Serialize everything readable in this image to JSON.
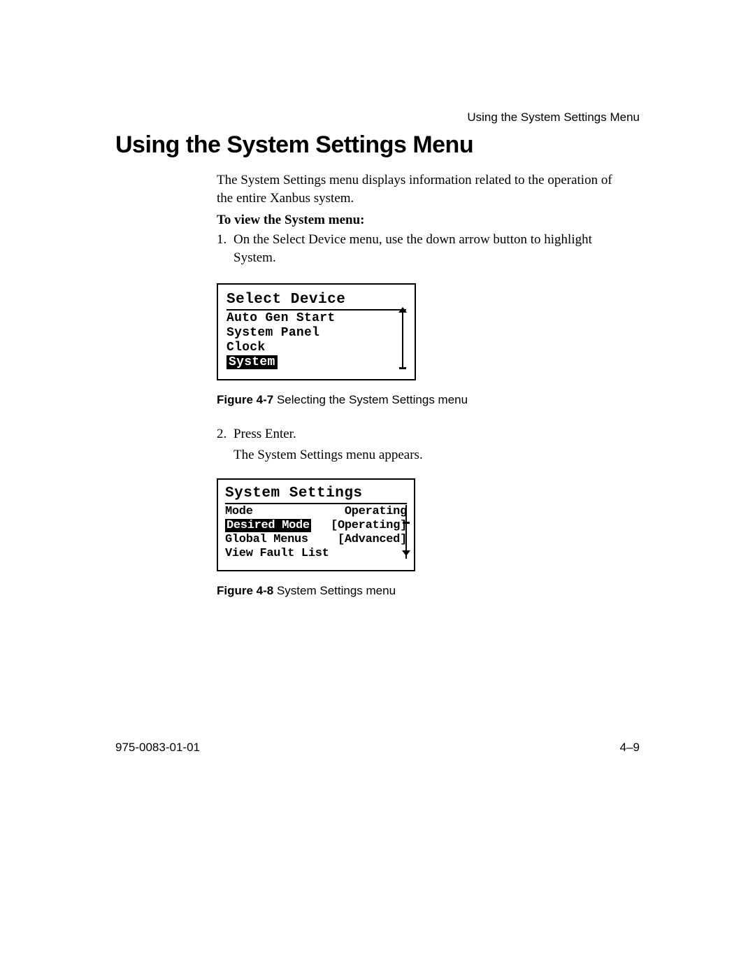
{
  "header": {
    "right": "Using the System Settings Menu"
  },
  "heading": "Using the System Settings Menu",
  "intro": "The System Settings menu displays information related to the operation of the entire Xanbus system.",
  "subheading": "To view the System menu:",
  "step1": {
    "num": "1.",
    "text": "On the Select Device menu, use the down arrow button to highlight System."
  },
  "fig1": {
    "title": "Select Device",
    "items": [
      "Auto Gen Start",
      "System Panel",
      "Clock",
      "System"
    ],
    "highlighted_index": 3
  },
  "caption1": {
    "bold": "Figure 4-7",
    "text": " Selecting the System Settings menu"
  },
  "step2": {
    "num": "2.",
    "text": "Press Enter."
  },
  "step2_followup": "The System Settings menu appears.",
  "fig2": {
    "title": "System Settings",
    "rows": [
      {
        "label": "Mode",
        "value": "Operating",
        "highlighted": false
      },
      {
        "label": "Desired Mode",
        "value": "[Operating]",
        "highlighted": true
      },
      {
        "label": "Global Menus",
        "value": "[Advanced]",
        "highlighted": false
      },
      {
        "label": "View Fault List",
        "value": "",
        "highlighted": false
      }
    ]
  },
  "caption2": {
    "bold": "Figure 4-8",
    "text": " System Settings menu"
  },
  "footer": {
    "left": "975-0083-01-01",
    "right": "4–9"
  }
}
